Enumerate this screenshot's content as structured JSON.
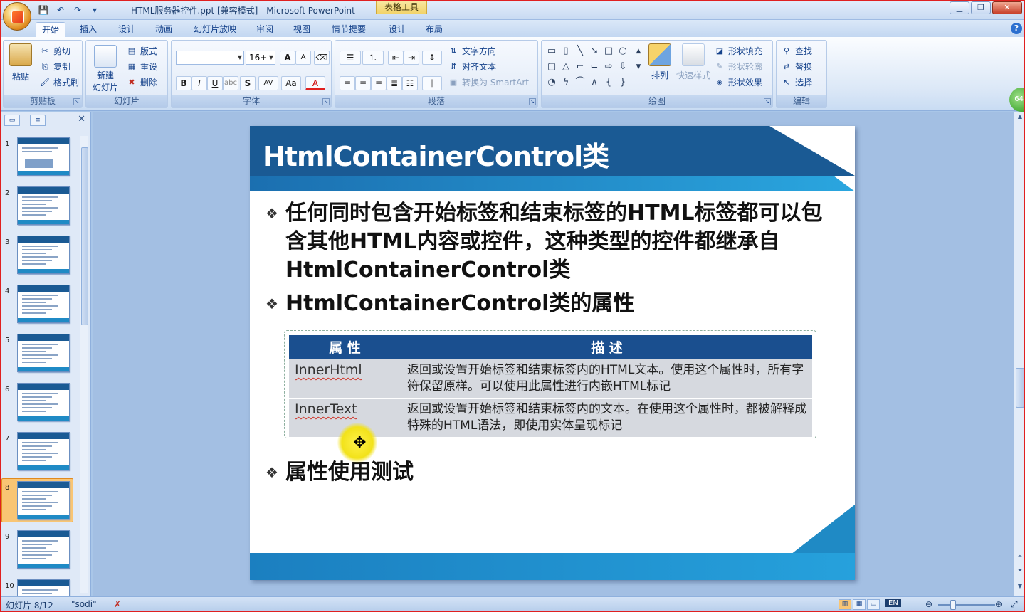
{
  "window": {
    "title": "HTML服务器控件.ppt [兼容模式] - Microsoft PowerPoint",
    "context_tab": "表格工具",
    "minimize": "▁",
    "restore": "❐",
    "close": "✕"
  },
  "tabs": [
    "开始",
    "插入",
    "设计",
    "动画",
    "幻灯片放映",
    "审阅",
    "视图",
    "情节提要",
    "设计",
    "布局"
  ],
  "ribbon": {
    "clipboard": {
      "label": "剪贴板",
      "paste": "粘贴",
      "cut": "剪切",
      "copy": "复制",
      "format_painter": "格式刷"
    },
    "slides": {
      "label": "幻灯片",
      "new_slide_1": "新建",
      "new_slide_2": "幻灯片",
      "layout": "版式",
      "reset": "重设",
      "delete": "删除"
    },
    "font": {
      "label": "字体",
      "font_name": "",
      "font_size": "16+",
      "bold": "B",
      "italic": "I",
      "underline": "U",
      "strike": "abc",
      "char_spacing": "AV",
      "change_case": "Aa",
      "font_color": "A",
      "grow": "A",
      "shrink": "A"
    },
    "paragraph": {
      "label": "段落",
      "text_direction": "文字方向",
      "align_text": "对齐文本",
      "smartart": "转换为 SmartArt"
    },
    "drawing": {
      "label": "绘图",
      "arrange": "排列",
      "quick_styles": "快速样式",
      "shape_fill": "形状填充",
      "shape_outline": "形状轮廓",
      "shape_effects": "形状效果"
    },
    "editing": {
      "label": "编辑",
      "find": "查找",
      "replace": "替换",
      "select": "选择"
    }
  },
  "panel": {
    "slide_count": 10,
    "selected": 8,
    "thumb_labels": [
      "1",
      "2",
      "3",
      "4",
      "5",
      "6",
      "7",
      "8",
      "9",
      "10"
    ]
  },
  "slide": {
    "title": "HtmlContainerControl类",
    "bullet1": "任何同时包含开始标签和结束标签的HTML标签都可以包含其他HTML内容或控件，这种类型的控件都继承自HtmlContainerControl类",
    "bullet2": "HtmlContainerControl类的属性",
    "bullet3": "属性使用测试",
    "bullet_glyph": "❖",
    "table": {
      "headers": [
        "属 性",
        "描  述"
      ],
      "rows": [
        {
          "prop": "InnerHtml",
          "desc": "返回或设置开始标签和结束标签内的HTML文本。使用这个属性时，所有字符保留原样。可以使用此属性进行内嵌HTML标记"
        },
        {
          "prop": "InnerText",
          "desc": "返回或设置开始标签和结束标签内的文本。在使用这个属性时，都被解释成特殊的HTML语法，即使用实体呈现标记"
        }
      ]
    }
  },
  "status": {
    "slide_indicator": "幻灯片 8/12",
    "theme": "\"sodi\"",
    "zoom_badge": "64",
    "lang": "EN"
  },
  "colors": {
    "title_bar": "#1a5a94",
    "accent_band": "#2aa6df",
    "table_header": "#1a4f8f",
    "table_cell": "#d6d9df"
  }
}
